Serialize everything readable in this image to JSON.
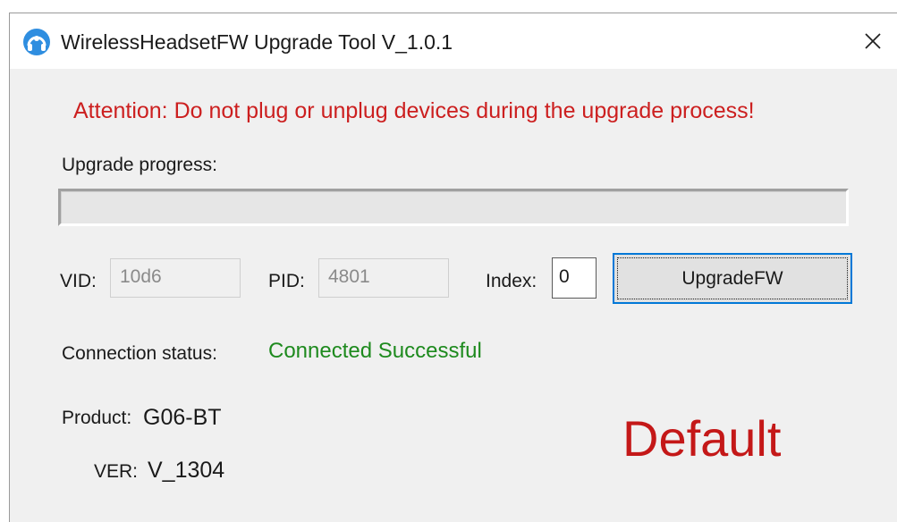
{
  "window": {
    "title": "WirelessHeadsetFW Upgrade Tool V_1.0.1",
    "icon": "headset-app-icon",
    "close_icon": "close-icon"
  },
  "attention": {
    "text": "Attention: Do not plug or unplug devices during the upgrade process!",
    "color": "#cc1f1f"
  },
  "progress": {
    "label": "Upgrade progress:",
    "value": 0
  },
  "device": {
    "vid_label": "VID:",
    "vid_value": "10d6",
    "pid_label": "PID:",
    "pid_value": "4801",
    "index_label": "Index:",
    "index_value": "0"
  },
  "actions": {
    "upgrade_label": "UpgradeFW",
    "accent": "#0078d7"
  },
  "connection": {
    "label": "Connection status:",
    "value": "Connected Successful",
    "color": "#1e8a1e"
  },
  "product": {
    "label": "Product:",
    "value": "G06-BT"
  },
  "version": {
    "label": "VER:",
    "value": "V_1304"
  },
  "status_display": {
    "text": "Default",
    "color": "#c41818"
  }
}
